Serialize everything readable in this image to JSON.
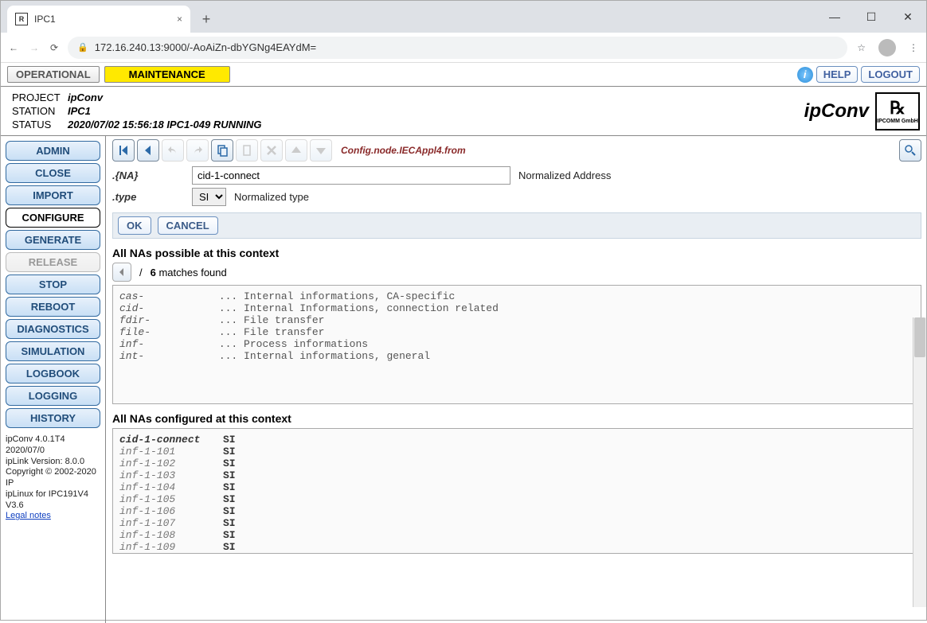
{
  "browser": {
    "tab_title": "IPC1",
    "url": "172.16.240.13:9000/-AoAiZn-dbYGNg4EAYdM="
  },
  "top": {
    "operational": "OPERATIONAL",
    "maintenance": "MAINTENANCE",
    "help": "HELP",
    "logout": "LOGOUT"
  },
  "header": {
    "project_lbl": "PROJECT",
    "project": "ipConv",
    "station_lbl": "STATION",
    "station": "IPC1",
    "status_lbl": "STATUS",
    "status": "2020/07/02 15:56:18 IPC1-049 RUNNING",
    "brand": "ipConv",
    "brand_logo_sub": "IPCOMM GmbH"
  },
  "sidebar": {
    "items": [
      {
        "label": "ADMIN"
      },
      {
        "label": "CLOSE"
      },
      {
        "label": "IMPORT"
      },
      {
        "label": "CONFIGURE"
      },
      {
        "label": "GENERATE"
      },
      {
        "label": "RELEASE"
      },
      {
        "label": "STOP"
      },
      {
        "label": "REBOOT"
      },
      {
        "label": "DIAGNOSTICS"
      },
      {
        "label": "SIMULATION"
      },
      {
        "label": "LOGBOOK"
      },
      {
        "label": "LOGGING"
      },
      {
        "label": "HISTORY"
      }
    ],
    "version": [
      "ipConv 4.0.1T4 2020/07/0",
      "ipLink Version: 8.0.0",
      "Copyright © 2002-2020 IP",
      "ipLinux for IPC191V4 V3.6"
    ],
    "legal": "Legal notes"
  },
  "toolbar": {
    "path": "Config.node.IECAppl4.from"
  },
  "form": {
    "na_lbl": ".{NA}",
    "na_value": "cid-1-connect",
    "na_desc": "Normalized Address",
    "type_lbl": ".type",
    "type_value": "SI",
    "type_desc": "Normalized type",
    "ok": "OK",
    "cancel": "CANCEL"
  },
  "possible": {
    "title": "All NAs possible at this context",
    "count_num": "6",
    "count_txt": " matches found",
    "rows": [
      {
        "na": "cas-",
        "desc": "Internal informations, CA-specific"
      },
      {
        "na": "cid-",
        "desc": "Internal Informations, connection related"
      },
      {
        "na": "fdir-",
        "desc": "File transfer"
      },
      {
        "na": "file-",
        "desc": "File transfer"
      },
      {
        "na": "inf-",
        "desc": "Process informations"
      },
      {
        "na": "int-",
        "desc": "Internal informations, general"
      }
    ]
  },
  "configured": {
    "title": "All NAs configured at this context",
    "rows": [
      {
        "na": "cid-1-connect",
        "type": "SI",
        "hl": true
      },
      {
        "na": "inf-1-101",
        "type": "SI"
      },
      {
        "na": "inf-1-102",
        "type": "SI"
      },
      {
        "na": "inf-1-103",
        "type": "SI"
      },
      {
        "na": "inf-1-104",
        "type": "SI"
      },
      {
        "na": "inf-1-105",
        "type": "SI"
      },
      {
        "na": "inf-1-106",
        "type": "SI"
      },
      {
        "na": "inf-1-107",
        "type": "SI"
      },
      {
        "na": "inf-1-108",
        "type": "SI"
      },
      {
        "na": "inf-1-109",
        "type": "SI"
      }
    ]
  }
}
